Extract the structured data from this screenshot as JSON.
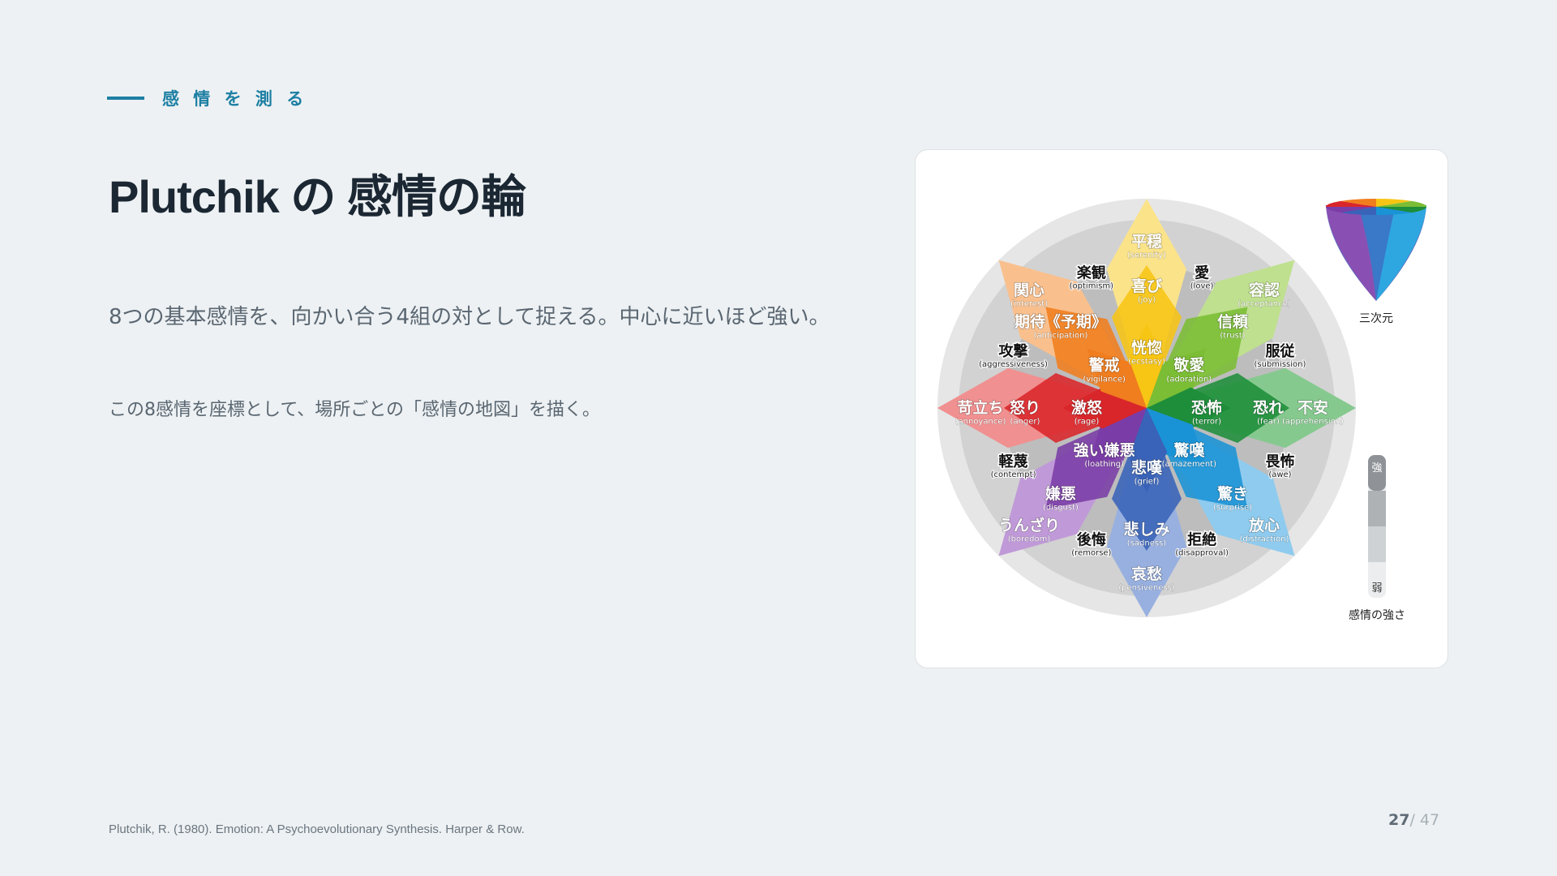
{
  "header": {
    "eyebrow": "感 情 を 測 る",
    "title": "Plutchik の 感情の輪"
  },
  "body": {
    "line1": "8つの基本感情を、向かい合う4組の対として捉える。中心に近いほど強い。",
    "line2": "この8感情を座標として、場所ごとの「感情の地図」を描く。"
  },
  "wheel": {
    "petals": [
      {
        "color": "#f7c514",
        "light": "#fbe38a",
        "inner": {
          "ja": "恍惚",
          "en": "(ecstasy)"
        },
        "mid": {
          "ja": "喜び",
          "en": "(joy)"
        },
        "outer": {
          "ja": "平穏",
          "en": "(serenity)"
        }
      },
      {
        "color": "#7bbd34",
        "light": "#bfe08f",
        "inner": {
          "ja": "敬愛",
          "en": "(adoration)"
        },
        "mid": {
          "ja": "信頼",
          "en": "(trust)"
        },
        "outer": {
          "ja": "容認",
          "en": "(acceptance)"
        }
      },
      {
        "color": "#1e8e3a",
        "light": "#86c98f",
        "inner": {
          "ja": "恐怖",
          "en": "(terror)"
        },
        "mid": {
          "ja": "恐れ",
          "en": "(fear)"
        },
        "outer": {
          "ja": "不安",
          "en": "(apprehension)"
        }
      },
      {
        "color": "#1a93d6",
        "light": "#8ecbee",
        "inner": {
          "ja": "驚嘆",
          "en": "(amazement)"
        },
        "mid": {
          "ja": "驚き",
          "en": "(surprise)"
        },
        "outer": {
          "ja": "放心",
          "en": "(distraction)"
        }
      },
      {
        "color": "#3963b8",
        "light": "#98b0e0",
        "inner": {
          "ja": "悲嘆",
          "en": "(grief)"
        },
        "mid": {
          "ja": "悲しみ",
          "en": "(sadness)"
        },
        "outer": {
          "ja": "哀愁",
          "en": "(pensiveness)"
        }
      },
      {
        "color": "#7a3ca6",
        "light": "#c09ad8",
        "inner": {
          "ja": "強い嫌悪",
          "en": "(loathing)"
        },
        "mid": {
          "ja": "嫌悪",
          "en": "(disgust)"
        },
        "outer": {
          "ja": "うんざり",
          "en": "(boredom)"
        }
      },
      {
        "color": "#d9262a",
        "light": "#f19090",
        "inner": {
          "ja": "激怒",
          "en": "(rage)"
        },
        "mid": {
          "ja": "怒り",
          "en": "(anger)"
        },
        "outer": {
          "ja": "苛立ち",
          "en": "(annoyance)"
        }
      },
      {
        "color": "#f07d1e",
        "light": "#f9c08e",
        "inner": {
          "ja": "警戒",
          "en": "(vigilance)"
        },
        "mid": {
          "ja": "期待《予期》",
          "en": "(anticipation)"
        },
        "outer": {
          "ja": "関心",
          "en": "(interest)"
        }
      }
    ],
    "dyads": [
      {
        "ja": "愛",
        "en": "(love)"
      },
      {
        "ja": "服従",
        "en": "(submission)"
      },
      {
        "ja": "畏怖",
        "en": "(awe)"
      },
      {
        "ja": "拒絶",
        "en": "(disapproval)"
      },
      {
        "ja": "後悔",
        "en": "(remorse)"
      },
      {
        "ja": "軽蔑",
        "en": "(contempt)"
      },
      {
        "ja": "攻撃",
        "en": "(aggressiveness)"
      },
      {
        "ja": "楽観",
        "en": "(optimism)"
      }
    ],
    "cone_label": "三次元",
    "intensity": {
      "label": "感情の強さ",
      "strong": "強",
      "weak": "弱",
      "colors": [
        "#8f9397",
        "#aeb2b5",
        "#cfd2d4",
        "#ecedee"
      ]
    }
  },
  "footer": {
    "source": "Plutchik, R. (1980). Emotion: A Psychoevolutionary Synthesis. Harper & Row.",
    "page_current": "27",
    "page_total": "/ 47"
  }
}
